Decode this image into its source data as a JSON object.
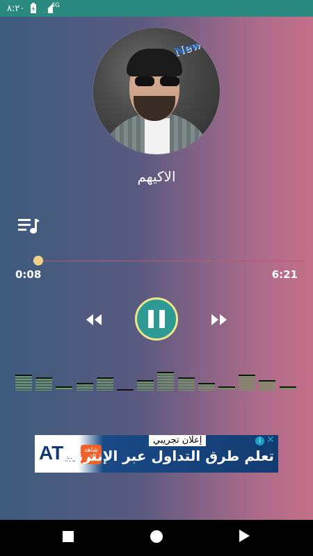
{
  "status_bar": {
    "time": "٨:٢٠",
    "network": "4G"
  },
  "album_art": {
    "tag": "New"
  },
  "track": {
    "title": "الاكيهم"
  },
  "player": {
    "current_time": "0:08",
    "duration": "6:21",
    "progress": 0.021,
    "state": "playing"
  },
  "equalizer": {
    "levels": [
      0.55,
      0.45,
      0.15,
      0.25,
      0.45,
      0.05,
      0.35,
      0.65,
      0.45,
      0.25,
      0.15,
      0.55,
      0.35,
      0.15
    ]
  },
  "ad": {
    "label": "إعلان تجريبي",
    "headline": "تعلم طرق التداول عبر الإنترنت",
    "logo": "AT",
    "logo_sub": "live",
    "badge_line1": "شاهد",
    "badge_line2": "الآن"
  },
  "colors": {
    "accent": "#2e9a94",
    "ring": "#f0e58a",
    "progress_track": "#b85a73",
    "eq_fill": "#6b9a5a"
  }
}
